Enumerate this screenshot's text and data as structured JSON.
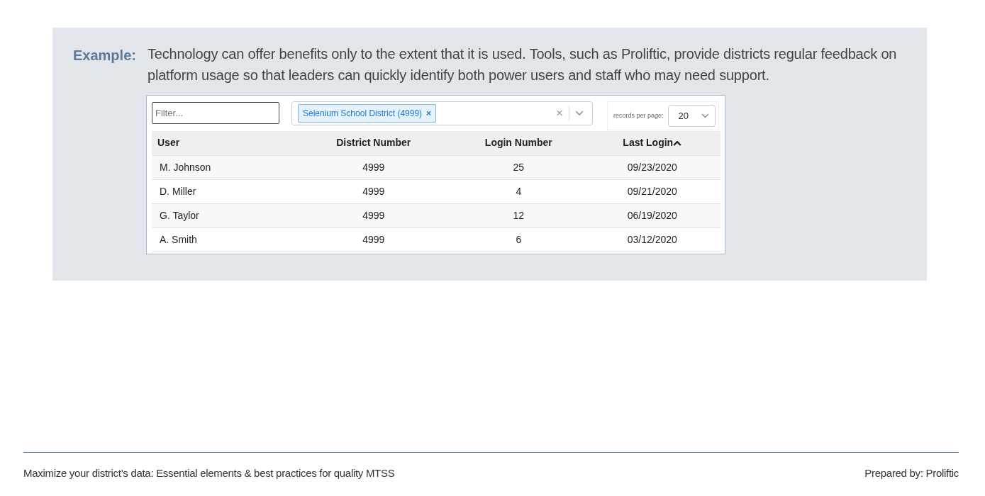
{
  "example": {
    "label": "Example:",
    "text": "Technology can offer benefits only to the extent that it is used. Tools, such as Proliftic, provide districts regular feedback on platform usage so that leaders can quickly identify both power users and staff who may need support."
  },
  "app": {
    "filter": {
      "placeholder": "Filter..."
    },
    "district_select": {
      "tags": [
        {
          "label": "Selenium School District (4999)",
          "remove": "×"
        }
      ],
      "clear": "×"
    },
    "page_size": {
      "label": "records per page:",
      "value": "20"
    },
    "table": {
      "columns": [
        {
          "label": "User",
          "sorted": false
        },
        {
          "label": "District Number",
          "sorted": false
        },
        {
          "label": "Login Number",
          "sorted": false
        },
        {
          "label": "Last Login",
          "sorted": true
        }
      ],
      "rows": [
        [
          "M. Johnson",
          "4999",
          "25",
          "09/23/2020"
        ],
        [
          "D. Miller",
          "4999",
          "4",
          "09/21/2020"
        ],
        [
          "G. Taylor",
          "4999",
          "12",
          "06/19/2020"
        ],
        [
          "A. Smith",
          "4999",
          "6",
          "03/12/2020"
        ]
      ]
    }
  },
  "footer": {
    "left": "Maximize your district’s data: Essential elements & best practices for quality MTSS",
    "right": "Prepared by: Proliftic"
  }
}
